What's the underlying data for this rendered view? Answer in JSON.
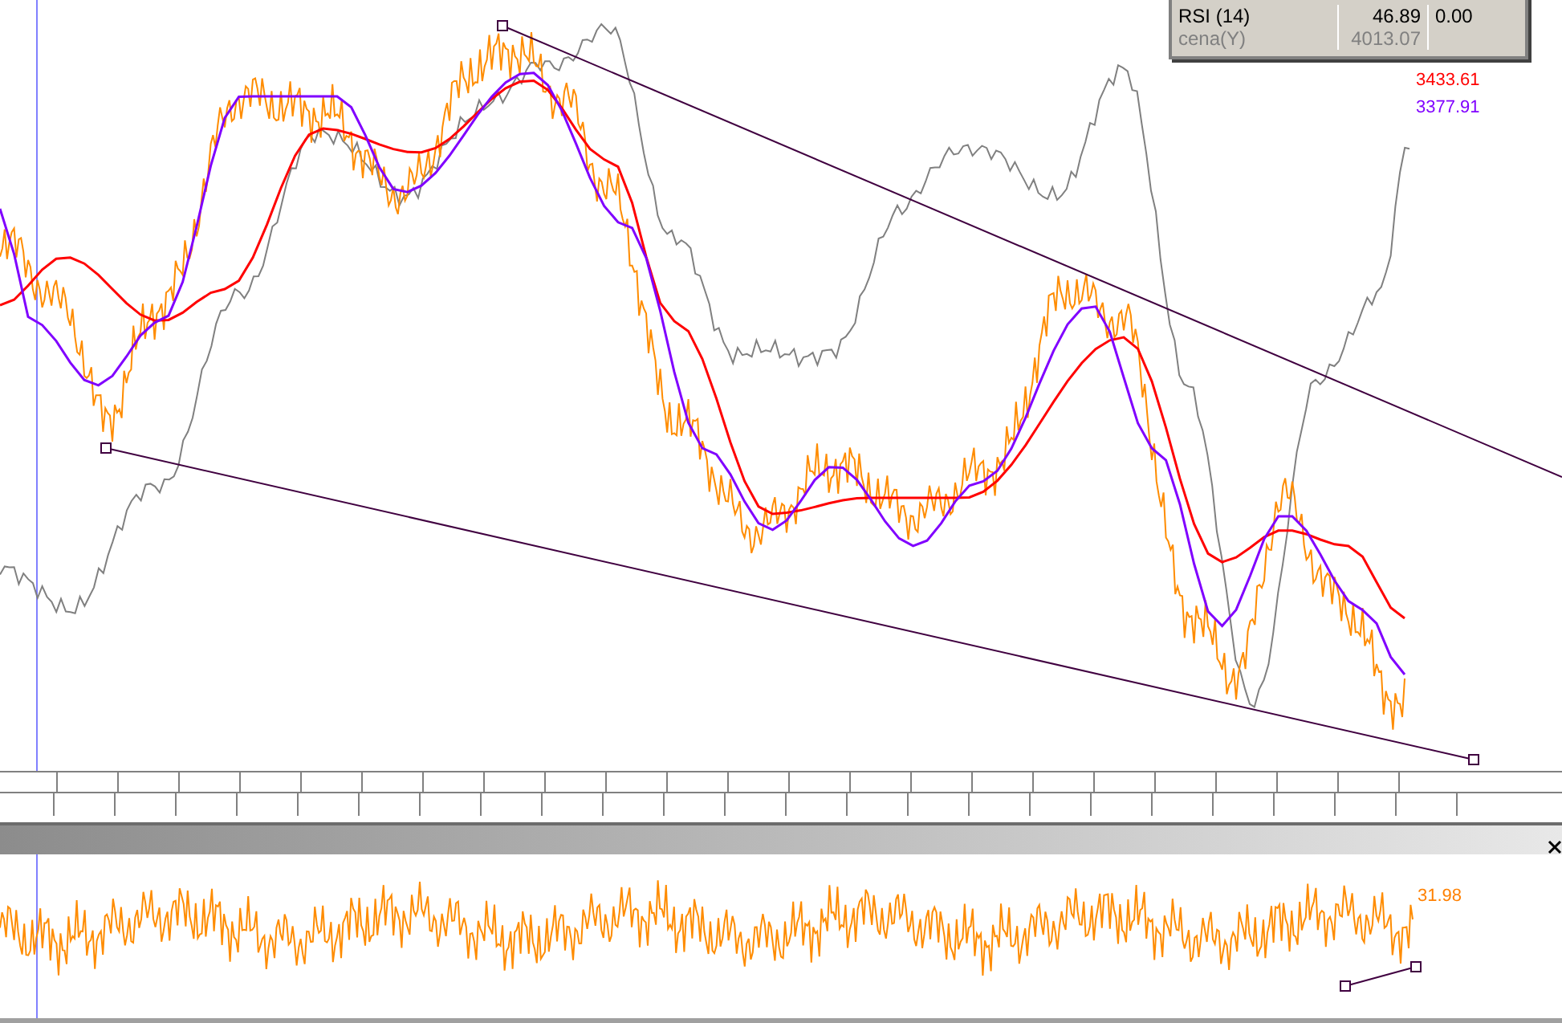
{
  "legend": {
    "rows": [
      {
        "label": "RSI (14)",
        "value": "46.89",
        "extra": "0.00",
        "color": "#000000"
      },
      {
        "label": "cena(Y)",
        "value": "4013.07",
        "color": "#808080"
      }
    ]
  },
  "price_labels": [
    {
      "text": "3433.61",
      "color": "#ff0000"
    },
    {
      "text": "3377.91",
      "color": "#8000ff"
    }
  ],
  "rsi_panel": {
    "reading": "31.98"
  }
}
